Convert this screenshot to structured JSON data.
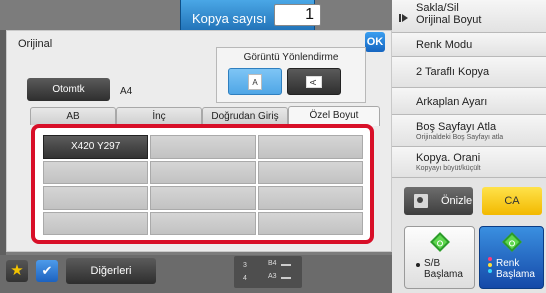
{
  "header": {
    "copies_label": "Kopya sayısı",
    "copies_value": "1"
  },
  "dialog": {
    "title": "Orijinal",
    "ok_label": "OK",
    "orientation": {
      "label": "Görüntü Yönlendirme",
      "portrait_glyph": "A",
      "landscape_glyph": "A"
    },
    "auto_button": "Otomtk",
    "auto_value": "A4",
    "tabs": [
      "AB",
      "İnç",
      "Doğrudan Giriş",
      "Özel Boyut"
    ],
    "active_tab": "Özel Boyut",
    "custom_sizes": [
      "X420 Y297",
      "",
      "",
      "",
      "",
      "",
      "",
      "",
      "",
      "",
      "",
      ""
    ]
  },
  "right_panel": {
    "items": [
      {
        "main": "Sakla/Sil",
        "sub": ""
      },
      {
        "main": "Orijinal Boyut",
        "sub": ""
      },
      {
        "main": "Renk Modu",
        "sub": ""
      },
      {
        "main": "2 Taraflı Kopya",
        "sub": ""
      },
      {
        "main": "Arkaplan Ayarı",
        "sub": ""
      },
      {
        "main": "Boş Sayfayı Atla",
        "sub": "Orijinaldeki Boş Sayfayı atla"
      },
      {
        "main": "Kopya. Orani",
        "sub": "Kopyayı büyüt/küçült"
      }
    ],
    "preview_label": "Önizle",
    "ca_label": "CA",
    "start_bw": {
      "line1": "S/B",
      "line2": "Başlama"
    },
    "start_color": {
      "line1": "Renk",
      "line2": "Başlama"
    }
  },
  "bottom": {
    "star_glyph": "★",
    "check_glyph": "✔",
    "others_label": "Diğerleri",
    "trays": [
      {
        "num": "3",
        "size": "B4"
      },
      {
        "num": "4",
        "size": "A3"
      }
    ]
  },
  "colors": {
    "accent_blue": "#1b6ab0",
    "highlight_red": "#d80f28",
    "ca_yellow": "#f2b900",
    "start_green": "#5fd84e"
  }
}
